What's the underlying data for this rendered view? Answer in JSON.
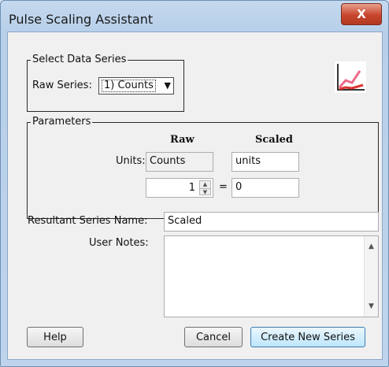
{
  "window": {
    "title": "Pulse Scaling Assistant",
    "close_glyph": "X"
  },
  "select_series": {
    "group_label": "Select Data Series",
    "raw_series_label": "Raw Series:",
    "raw_series_value": "1) Counts",
    "dropdown_glyph": "▼"
  },
  "parameters": {
    "group_label": "Parameters",
    "raw_header": "Raw",
    "scaled_header": "Scaled",
    "units_label": "Units:",
    "raw_units": "Counts",
    "scaled_units": "units",
    "raw_factor": "1",
    "equals": "=",
    "scaled_factor": "0"
  },
  "resultant": {
    "label": "Resultant Series Name:",
    "value": "Scaled"
  },
  "notes": {
    "label": "User Notes:",
    "value": "",
    "scroll_up": "▲",
    "scroll_down": "▼"
  },
  "buttons": {
    "help": "Help",
    "cancel": "Cancel",
    "create": "Create New Series"
  },
  "icons": {
    "chart": "line-chart-icon"
  },
  "colors": {
    "title_bar": "#c5d9ef",
    "close": "#c8452d",
    "client": "#f0f0f0"
  }
}
